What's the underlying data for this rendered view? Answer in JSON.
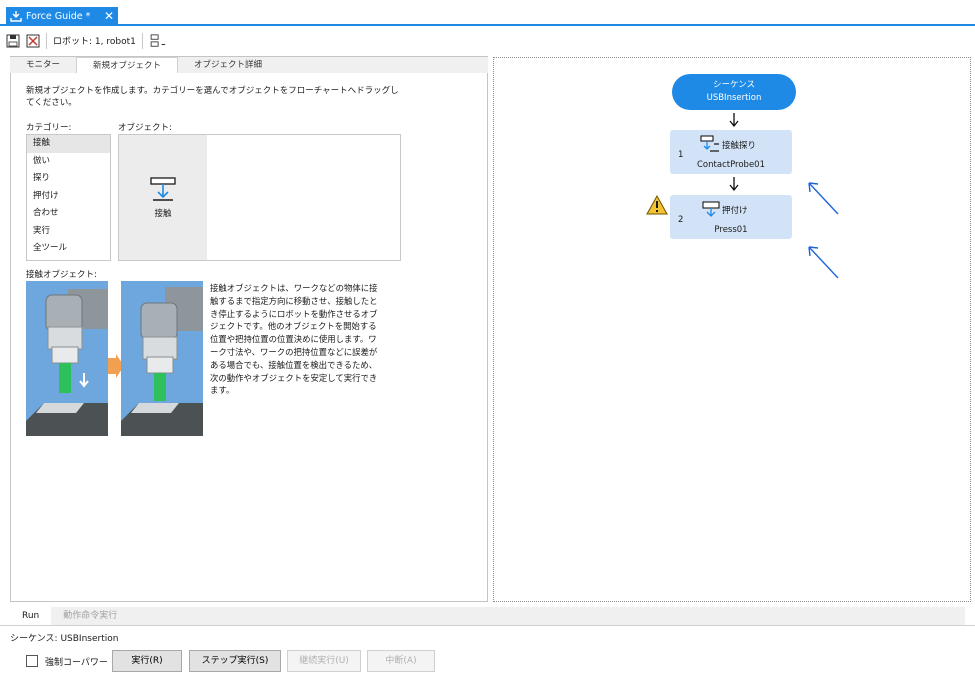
{
  "tab": {
    "title": "Force Guide *",
    "close": "✕"
  },
  "toolbar": {
    "robot": "ロボット: 1, robot1"
  },
  "left_tabs": [
    "モニター",
    "新規オブジェクト",
    "オブジェクト詳細"
  ],
  "intro_text": "新規オブジェクトを作成します。カテゴリーを選んでオブジェクトをフローチャートへドラッグしてください。",
  "category_label": "カテゴリー:",
  "object_label": "オブジェクト:",
  "categories": [
    "接触",
    "倣い",
    "探り",
    "押付け",
    "合わせ",
    "実行",
    "全ツール"
  ],
  "selected_category": "接触",
  "object_tile_label": "接触",
  "contact_section_label": "接触オブジェクト:",
  "description": "接触オブジェクトは、ワークなどの物体に接触するまで指定方向に移動させ、接触したとき停止するようにロボットを動作させるオブジェクトです。他のオブジェクトを開始する位置や把持位置の位置決めに使用します。ワーク寸法や、ワークの把持位置などに誤差がある場合でも、接触位置を検出できるため、次の動作やオブジェクトを安定して実行できます。",
  "flow": {
    "sequence": {
      "label": "シーケンス",
      "name": "USBInsertion"
    },
    "nodes": [
      {
        "num": "1",
        "title": "接触探り",
        "name": "ContactProbe01",
        "warning": false
      },
      {
        "num": "2",
        "title": "押付け",
        "name": "Press01",
        "warning": true
      }
    ]
  },
  "bottom": {
    "tabs": [
      "Run",
      "動作命令実行"
    ],
    "sequence_status": "シーケンス: USBInsertion",
    "checkbox_label": "強制コーパワー",
    "buttons": {
      "run": "実行(R)",
      "step": "ステップ実行(S)",
      "continue": "継続実行(U)",
      "abort": "中断(A)"
    }
  },
  "colors": {
    "accent": "#1e8ae6",
    "node_bg": "#d3e3f7",
    "annotation_arrow": "#1e64d8",
    "warning": "#f2c233"
  }
}
